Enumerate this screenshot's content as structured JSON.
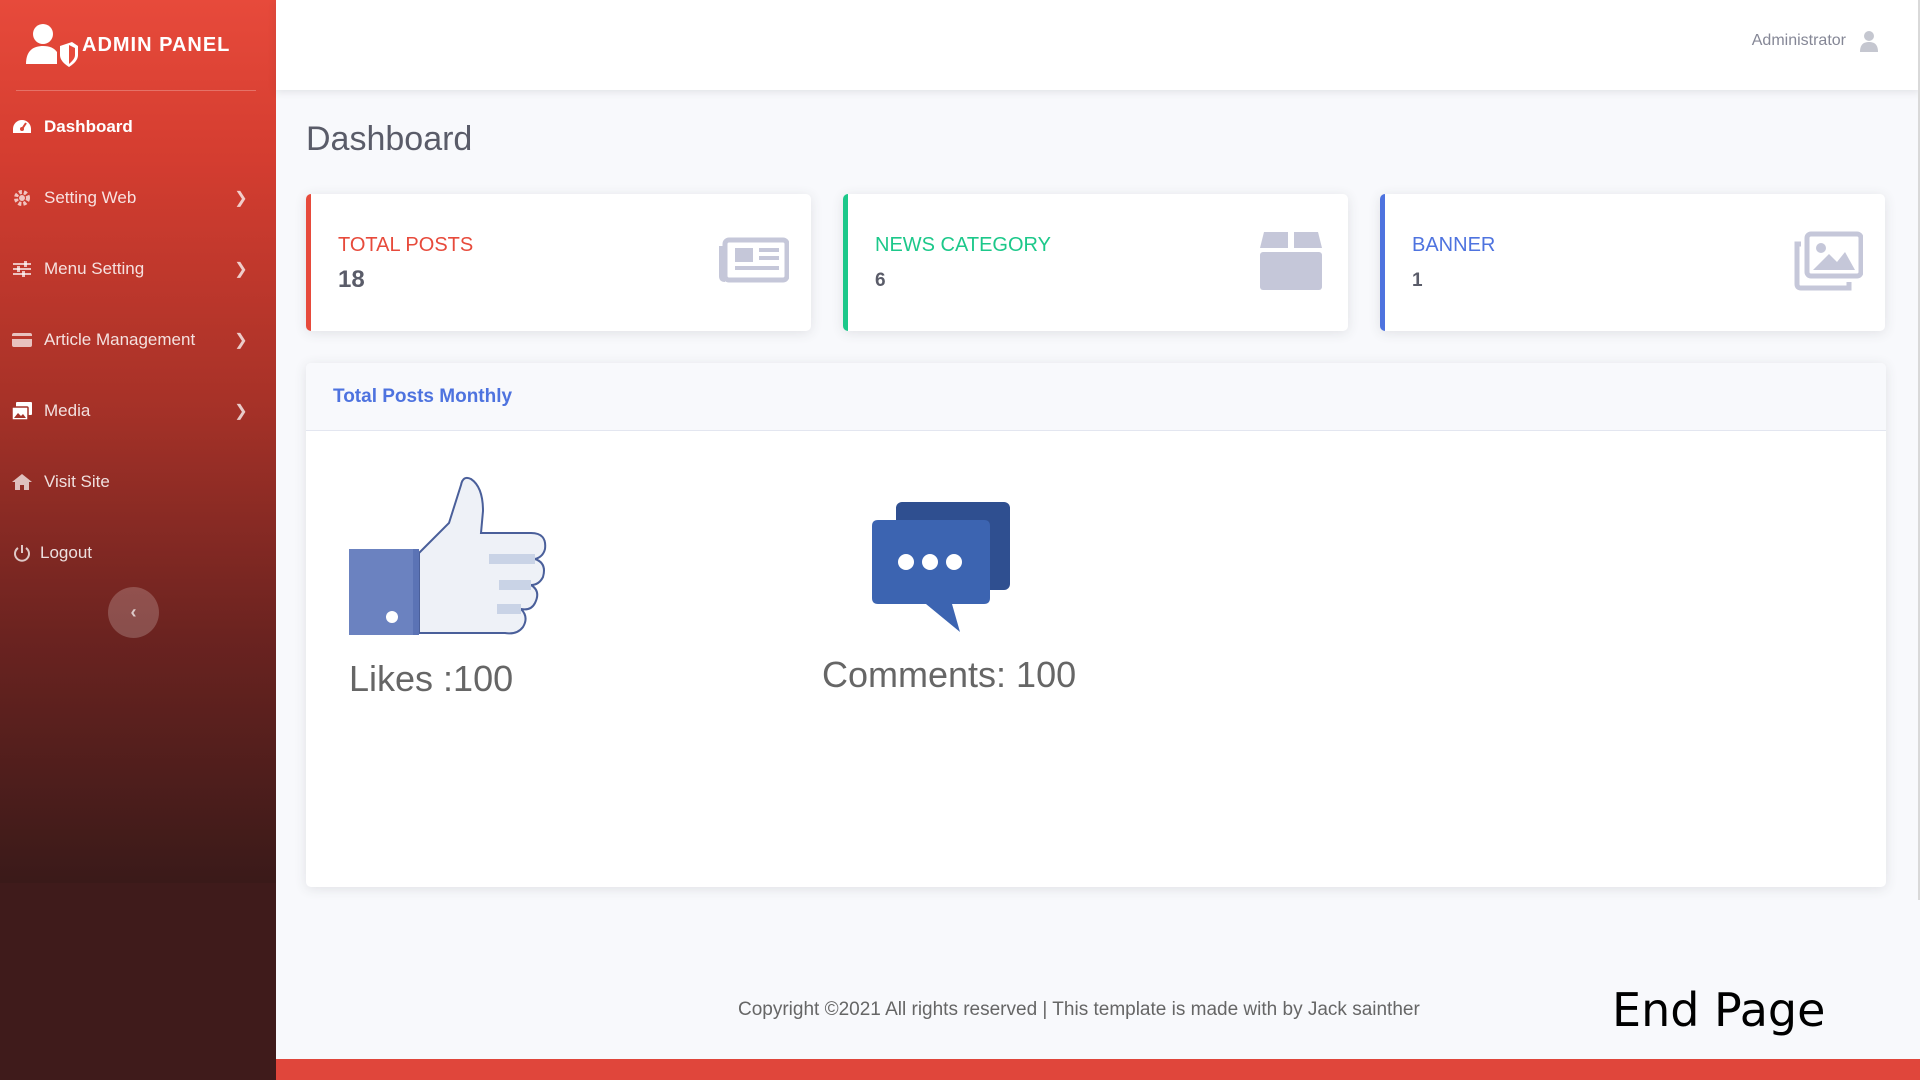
{
  "brand": {
    "title": "ADMIN PANEL"
  },
  "sidebar": {
    "items": [
      {
        "label": "Dashboard",
        "icon": "dashboard-icon",
        "active": true
      },
      {
        "label": "Setting Web",
        "icon": "gear-icon"
      },
      {
        "label": "Menu Setting",
        "icon": "sliders-icon"
      },
      {
        "label": "Article Management",
        "icon": "credit-card-icon"
      },
      {
        "label": "Media",
        "icon": "images-icon"
      },
      {
        "label": "Visit Site",
        "icon": "home-icon"
      },
      {
        "label": "Logout",
        "icon": "power-icon"
      }
    ],
    "toggle_glyph": "‹"
  },
  "topbar": {
    "user_name": "Administrator"
  },
  "page": {
    "title": "Dashboard"
  },
  "cards": [
    {
      "label": "TOTAL POSTS",
      "value": "18",
      "accent": "#e74a3b",
      "icon": "newspaper-icon"
    },
    {
      "label": "NEWS CATEGORY",
      "value": "6",
      "accent": "#1cc88a",
      "icon": "box-icon"
    },
    {
      "label": "BANNER",
      "value": "1",
      "accent": "#4e73df",
      "icon": "images-icon"
    }
  ],
  "panel": {
    "title": "Total Posts Monthly",
    "likes_text": "Likes :100",
    "comments_text": "Comments: 100"
  },
  "footer": {
    "text": "Copyright ©2021 All rights reserved | This template is made with  by Jack sainther"
  },
  "overlay": {
    "end_page": "End Page"
  },
  "colors": {
    "sidebar_top": "#e74a3b",
    "primary": "#4e73df",
    "success": "#1cc88a",
    "danger": "#e74a3b",
    "text_muted": "#858796"
  }
}
